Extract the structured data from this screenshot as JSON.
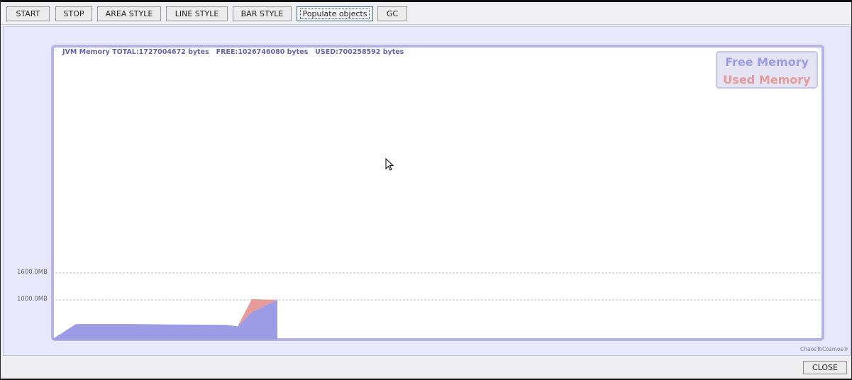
{
  "toolbar": {
    "buttons": {
      "start": "START",
      "stop": "STOP",
      "area_style": "AREA STYLE",
      "line_style": "LINE STYLE",
      "bar_style": "BAR STYLE",
      "populate": "Populate objects",
      "gc": "GC"
    },
    "focused_button": "populate"
  },
  "monitor": {
    "jvm_status": "JVM Memory TOTAL:1727004672 bytes   FREE:1026746080 bytes   USED:700258592 bytes",
    "legend": {
      "free": "Free Memory",
      "used": "Used Memory"
    },
    "credit": "ChaosToCosmos®",
    "ticks": [
      "1600.0MB",
      "1000.0MB"
    ]
  },
  "chart_data": {
    "type": "area",
    "title": "",
    "xlabel": "",
    "ylabel": "",
    "y_tick_labels": [
      "1600.0MB",
      "1000.0MB"
    ],
    "ylim": [
      0,
      1600
    ],
    "grid": true,
    "legend": "top-right",
    "series": [
      {
        "name": "Free Memory",
        "color": "#9c9ce6",
        "values": [
          0,
          390,
          390,
          380,
          375,
          370,
          330,
          690,
          1000
        ]
      },
      {
        "name": "Used Memory",
        "color": "#e69a9a",
        "values": [
          0,
          0,
          0,
          0,
          0,
          0,
          0,
          330,
          0
        ]
      }
    ]
  },
  "footer": {
    "close": "CLOSE"
  }
}
